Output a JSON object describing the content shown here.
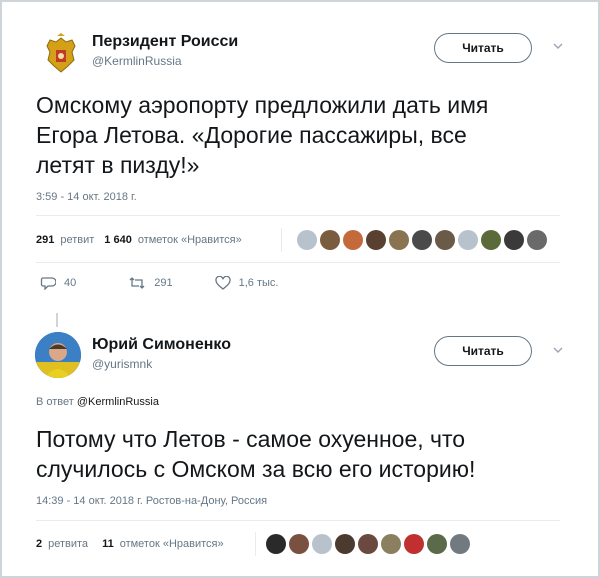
{
  "tweet1": {
    "name": "Перзидент Роисси",
    "handle": "@KermlinRussia",
    "follow_label": "Читать",
    "text_line1": "Омскому аэропорту предложили дать имя",
    "text_line2": "Егора Летова. «Дорогие пассажиры, все",
    "text_line3": "летят в пизду!»",
    "timestamp": "3:59 - 14 окт. 2018 г.",
    "retweets_count": "291",
    "retweets_label": "ретвит",
    "likes_count": "1 640",
    "likes_label": "отметок «Нравится»",
    "reply_count": "40",
    "retweet_action_count": "291",
    "like_action_count": "1,6 тыс.",
    "colors": {
      "accent": "#1da1f2",
      "muted": "#657786"
    }
  },
  "tweet2": {
    "name": "Юрий Симоненко",
    "handle": "@yurismnk",
    "follow_label": "Читать",
    "reply_prefix": "В ответ",
    "reply_handle": "@KermlinRussia",
    "text_line1": "Потому что Летов - самое охуенное, что",
    "text_line2": "случилось с Омском за всю его историю!",
    "timestamp": "14:39 - 14 окт. 2018 г. Ростов-на-Дону, Россия",
    "retweets_count": "2",
    "retweets_label": "ретвита",
    "likes_count": "11",
    "likes_label": "отметок «Нравится»"
  },
  "icons": {
    "reply": "reply-icon",
    "retweet": "retweet-icon",
    "like": "heart-icon",
    "more": "chevron-down-icon"
  }
}
